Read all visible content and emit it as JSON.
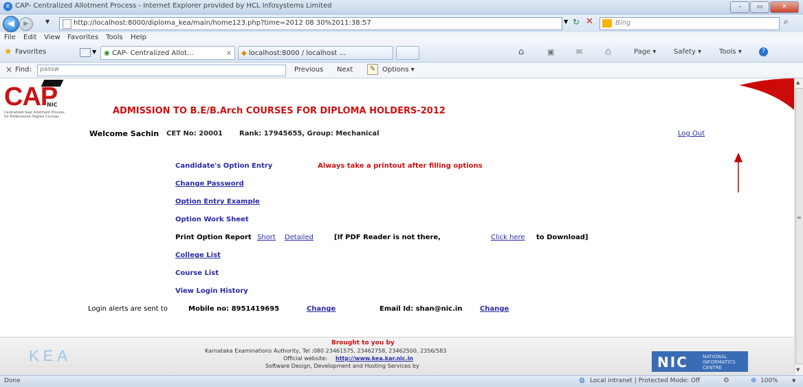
{
  "window": {
    "title": "CAP- Centralized Allotment Process - Internet Explorer provided by HCL Infosystems Limited",
    "controls": [
      "–",
      "▭",
      "✕"
    ]
  },
  "address": {
    "url": "http://localhost:8000/diploma_kea/main/home123.php?time=2012 08 30%2011:38:57",
    "search_placeholder": "Bing"
  },
  "menu": [
    "File",
    "Edit",
    "View",
    "Favorites",
    "Tools",
    "Help"
  ],
  "favbar": {
    "favorites": "Favorites",
    "tabs": [
      "CAP- Centralized Allot...",
      "localhost:8000 / localhost ..."
    ],
    "tools": [
      "Page ▾",
      "Safety ▾",
      "Tools ▾"
    ]
  },
  "findbar": {
    "close": "×",
    "label": "Find:",
    "value": "passw",
    "previous": "Previous",
    "next": "Next",
    "options": "Options ▾"
  },
  "page": {
    "logo_text": "CAP",
    "logo_sub": "NIC",
    "logo_caption1": "Centralized Seat Allotment Process",
    "logo_caption2": "for Professional Degree Courses",
    "heading": "ADMISSION TO B.E/B.Arch COURSES FOR DIPLOMA HOLDERS-2012",
    "welcome": "Welcome Sachin",
    "cet_no": "CET No: 20001",
    "rank_group": "Rank: 17945655, Group: Mechanical",
    "logout": "Log Out",
    "option_entry": "Candidate's Option Entry",
    "printout_note": "Always take a printout after filling options",
    "change_password": "Change Password",
    "option_entry_example": "Option Entry Example",
    "option_work_sheet": "Option Work Sheet",
    "print_report_label": "Print Option Report",
    "short": "Short",
    "detailed": "Detailed",
    "pdf_note_pre": "[If PDF Reader is not there,",
    "click_here": "Click here",
    "pdf_note_post": "to Download]",
    "college_list": "College List",
    "course_list": "Course List",
    "login_history": "View Login History",
    "alerts_pre": "Login alerts are sent to",
    "mobile": "Mobile no: 8951419695",
    "change1": "Change",
    "email": "Email Id: shan@nic.in",
    "change2": "Change"
  },
  "footer": {
    "brought": "Brought to you by",
    "authority": "Karnataka Examinations Authority, Tel :080 23461575, 23462758, 23462500, 2356/583",
    "website_label": "Official website:",
    "website": "http://www.kea.kar.nic.in",
    "software": "Software Design, Development and Hosting Services by",
    "kea_logo": "KEA",
    "nic_logo": "NIC",
    "nic_caption": "NATIONAL INFORMATICS CENTRE"
  },
  "status": {
    "left": "Done",
    "zone": "Local intranet | Protected Mode: Off",
    "zoom": "100%"
  },
  "colors": {
    "heading_red": "#d01010",
    "link_blue": "#2a2aa8",
    "arrow_red": "#c00000"
  }
}
